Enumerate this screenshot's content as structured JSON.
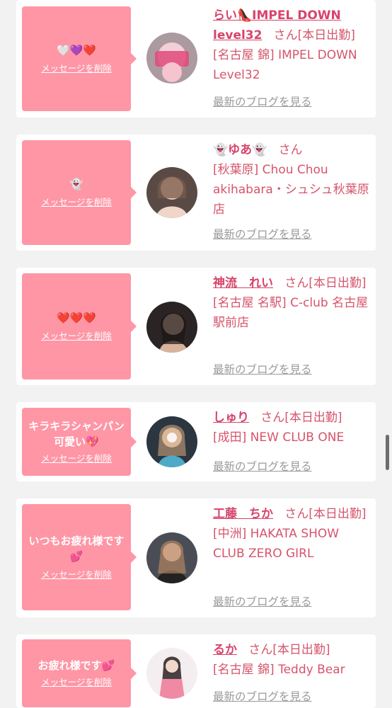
{
  "delete_label": "メッセージを削除",
  "blog_label": "最新のブログを見る",
  "san": "さん",
  "cards": [
    {
      "message": "🤍💜❤️",
      "name": "らい👠IMPEL DOWN level32",
      "status": "[本日出勤]",
      "shop": "[名古屋 錦] IMPEL DOWN Level32",
      "avatar_icon": "profile-photo"
    },
    {
      "message": "👻",
      "name": "👻ゆあ👻",
      "status": "",
      "shop": "[秋葉原] Chou Chou akihabara・シュシュ秋葉原店",
      "avatar_icon": "profile-photo"
    },
    {
      "message": "❤️❤️❤️",
      "name": "神流　れい",
      "status": "[本日出勤]",
      "shop": "[名古屋 名駅] C-club 名古屋駅前店",
      "avatar_icon": "profile-photo"
    },
    {
      "message": "キラキラシャンパン可愛い💖",
      "name": "しゅり",
      "status": "[本日出勤]",
      "shop": "[成田] NEW CLUB ONE",
      "avatar_icon": "profile-photo"
    },
    {
      "message": "いつもお疲れ様です💕",
      "name": "工藤　ちか",
      "status": "[本日出勤]",
      "shop": "[中洲] HAKATA SHOW CLUB ZERO GIRL",
      "avatar_icon": "profile-photo"
    },
    {
      "message": "お疲れ様です💕",
      "name": "るか",
      "status": "[本日出勤]",
      "shop": "[名古屋 錦] Teddy Bear",
      "avatar_icon": "profile-photo"
    }
  ],
  "colors": {
    "bubble": "#fe96a6",
    "accent": "#d6446a",
    "background": "#f2f2f2"
  }
}
